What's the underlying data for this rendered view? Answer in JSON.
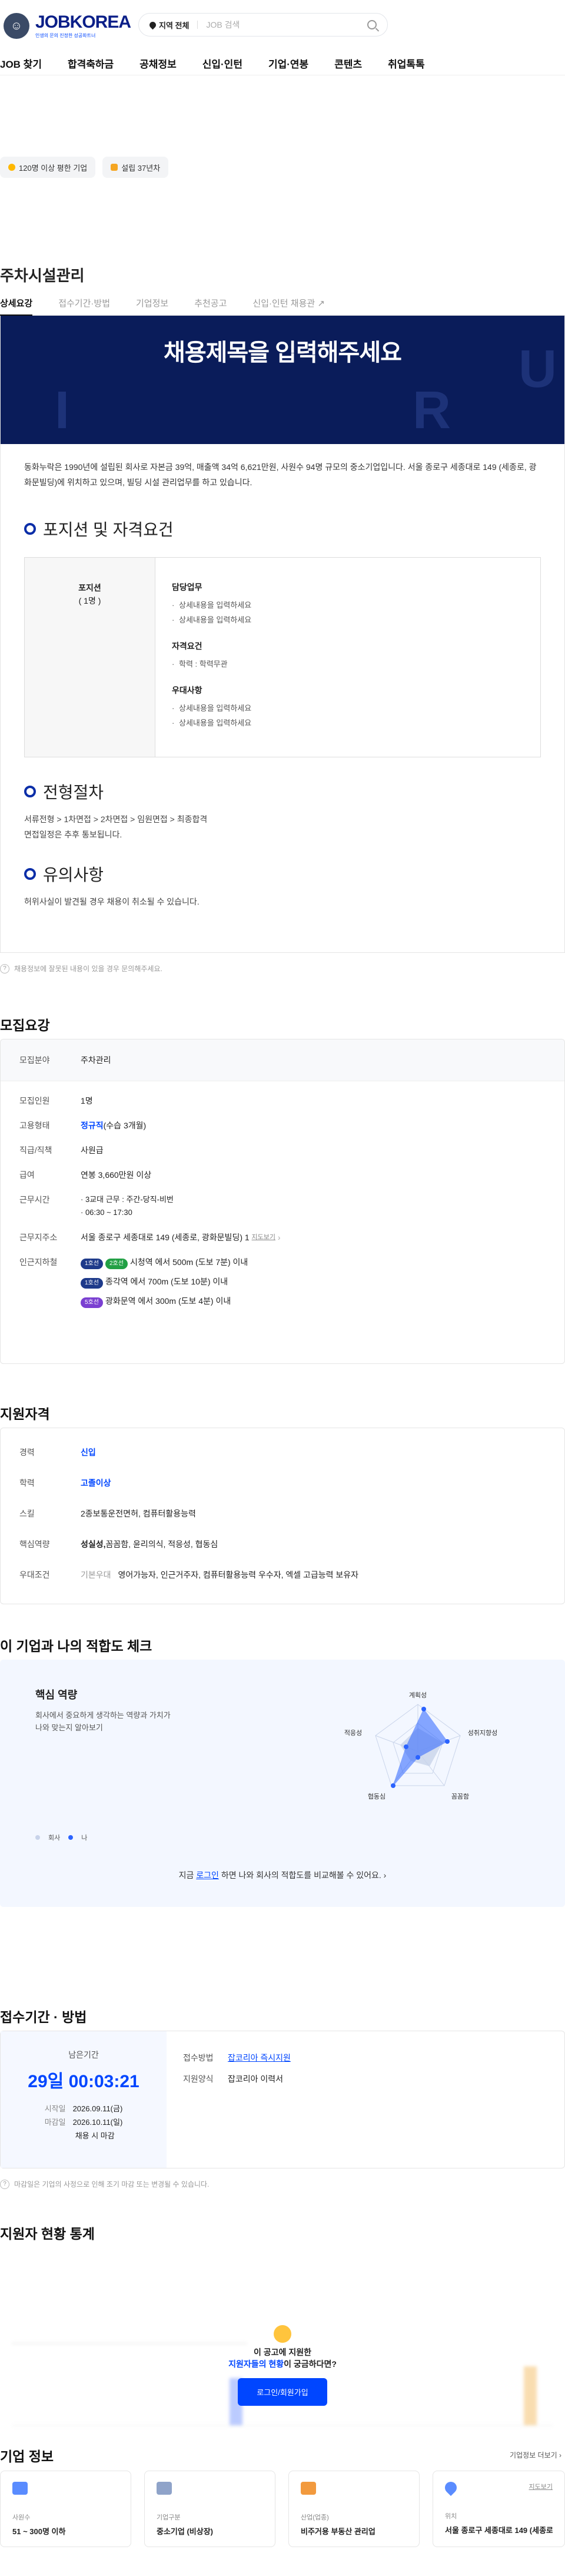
{
  "header": {
    "logo_text": "JOBKOREA",
    "logo_sub": "인생의 문의 진정한 성공파트너",
    "location_label": "지역 전체",
    "search_placeholder": "JOB 검색",
    "nav": [
      "JOB 찾기",
      "합격축하금",
      "공채정보",
      "신입·인턴",
      "기업·연봉",
      "콘텐츠",
      "취업톡톡"
    ]
  },
  "badges": [
    "120명 이상 평한 기업",
    "설립 37년차"
  ],
  "company_title": "주차시설관리",
  "tabs": [
    "상세요강",
    "접수기간·방법",
    "기업정보",
    "추천공고",
    "신입·인턴 채용관"
  ],
  "banner": {
    "title": "채용제목을 입력해주세요"
  },
  "intro_text": "동화누락은 1990년에 설립된 회사로 자본금 39억, 매출액 34억 6,621만원, 사원수 94명 규모의 중소기업입니다. 서울 종로구 세종대로 149 (세종로, 광화문빌딩)에 위치하고 있으며, 빌딩 시설 관리업무를 하고 있습니다.",
  "position": {
    "heading": "포지션 및 자격요건",
    "role": "포지션",
    "count": "( 1명 )",
    "duty_title": "담당업무",
    "duty_items": [
      "상세내용을 입력하세요",
      "상세내용을 입력하세요"
    ],
    "qual_title": "자격요건",
    "qual_items": [
      "학력 : 학력무관"
    ],
    "pref_title": "우대사항",
    "pref_items": [
      "상세내용을 입력하세요",
      "상세내용을 입력하세요"
    ]
  },
  "process": {
    "heading": "전형절차",
    "text1": "서류전형 > 1차면접 > 2차면접 > 임원면접 > 최종합격",
    "text2": "면접일정은 추후 통보됩니다."
  },
  "caution": {
    "heading": "유의사항",
    "text": "허위사실이 발견될 경우 채용이 취소될 수 있습니다."
  },
  "report_note": "채용정보에 잘못된 내용이 있을 경우 문의해주세요.",
  "recruit": {
    "heading": "모집요강",
    "field_label": "모집분야",
    "field_value": "주차관리",
    "count_label": "모집인원",
    "count_value": "1명",
    "type_label": "고용형태",
    "type_value": "정규직",
    "type_extra": "(수습 3개월)",
    "rank_label": "직급/직책",
    "rank_value": "사원급",
    "salary_label": "급여",
    "salary_value": "연봉 3,660만원 이상",
    "hours_label": "근무시간",
    "hours_1": "3교대 근무 : 주간-당직-비번",
    "hours_2": "06:30 ~ 17:30",
    "addr_label": "근무지주소",
    "addr_value": "서울 종로구 세종대로 149 (세종로, 광화문빌딩) 1",
    "map_label": "지도보기",
    "subway_label": "인근지하철",
    "subway": [
      {
        "line": "1호선",
        "line2": "2호선",
        "text": "시청역 에서 500m (도보 7분) 이내"
      },
      {
        "line": "1호선",
        "text": "종각역 에서 700m (도보 10분) 이내"
      },
      {
        "line": "5호선",
        "text": "광화문역 에서 300m (도보 4분) 이내"
      }
    ]
  },
  "qualify": {
    "heading": "지원자격",
    "career_label": "경력",
    "career_value": "신입",
    "edu_label": "학력",
    "edu_value": "고졸이상",
    "skill_label": "스킬",
    "skill_value": "2종보통운전면허, 컴퓨터활용능력",
    "core_label": "핵심역량",
    "core_value_b": "성실성,",
    "core_value": " 꼼꼼함, 윤리의식, 적응성, 협동심",
    "pref_label": "우대조건",
    "pref_sub": "기본우대",
    "pref_value": "영어가능자, 인근거주자, 컴퓨터활용능력 우수자, 엑셀 고급능력 보유자"
  },
  "fit": {
    "heading": "이 기업과 나의 적합도 체크",
    "title": "핵심 역량",
    "desc1": "회사에서 중요하게 생각하는 역량과 가치가",
    "desc2": "나와 맞는지 알아보기",
    "legend_company": "회사",
    "legend_me": "나",
    "axes": [
      "계획성",
      "성취지향성",
      "꼼꼼함",
      "협동심",
      "적응성"
    ],
    "cta_pre": "지금 ",
    "cta_link": "로그인",
    "cta_post": " 하면 나와 회사의 적합도를 비교해볼 수 있어요."
  },
  "deadline": {
    "heading": "접수기간 · 방법",
    "remain_label": "남은기간",
    "remain_value": "29일 00:03:21",
    "start_label": "시작일",
    "start_value": "2026.09.11(금)",
    "end_label": "마감일",
    "end_value": "2026.10.11(일)",
    "note": "채용 시 마감",
    "method_label": "접수방법",
    "method_value": "잡코리아 즉시지원",
    "form_label": "지원양식",
    "form_value": "잡코리아 이력서",
    "footnote": "마감일은 기업의 사정으로 인해 조기 마감 또는 변경될 수 있습니다."
  },
  "stats": {
    "heading": "지원자 현황 통계",
    "overlay_1": "이 공고에 지원한",
    "overlay_2a": "지원자들의 현황",
    "overlay_2b": "이 궁금하다면?",
    "login_btn": "로그인/회원가입"
  },
  "company": {
    "heading": "기업 정보",
    "more": "기업정보 더보기",
    "cards": [
      {
        "label": "사원수",
        "value": "51 ~ 300명 이하",
        "color": "#5a8cff"
      },
      {
        "label": "기업구분",
        "value": "중소기업 (비상장)",
        "color": "#8fa3c9"
      },
      {
        "label": "산업(업종)",
        "value": "비주거용 부동산 관리업",
        "color": "#f29a3e"
      },
      {
        "label": "위치",
        "value": "서울 종로구 세종대로 149 (세종로",
        "color": "#5a8cff",
        "extra": "지도보기"
      }
    ]
  }
}
